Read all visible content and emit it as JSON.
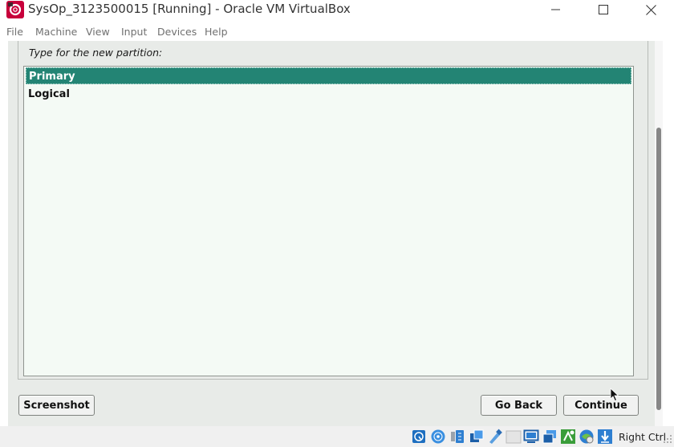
{
  "window": {
    "title": "SysOp_3123500015 [Running] - Oracle VM VirtualBox",
    "app_icon": "debian-swirl-icon"
  },
  "menu": [
    "File",
    "Machine",
    "View",
    "Input",
    "Devices",
    "Help"
  ],
  "installer": {
    "question": "Type for the new partition:",
    "options": [
      {
        "label": "Primary",
        "selected": true
      },
      {
        "label": "Logical",
        "selected": false
      }
    ],
    "buttons": {
      "screenshot": "Screenshot",
      "go_back": "Go Back",
      "continue": "Continue"
    }
  },
  "status_bar": {
    "icons": [
      "hard-disk-icon",
      "optical-drive-icon",
      "audio-icon",
      "network-icon",
      "usb-icon",
      "shared-folders-icon",
      "display-icon",
      "video-capture-icon",
      "recording-icon",
      "guest-additions-icon",
      "mouse-integration-icon",
      "keyboard-capture-icon"
    ],
    "host_key": "Right Ctrl"
  },
  "colors": {
    "selection": "#238474",
    "list_background": "#f4faf5",
    "installer_background": "#e8ebe8"
  }
}
